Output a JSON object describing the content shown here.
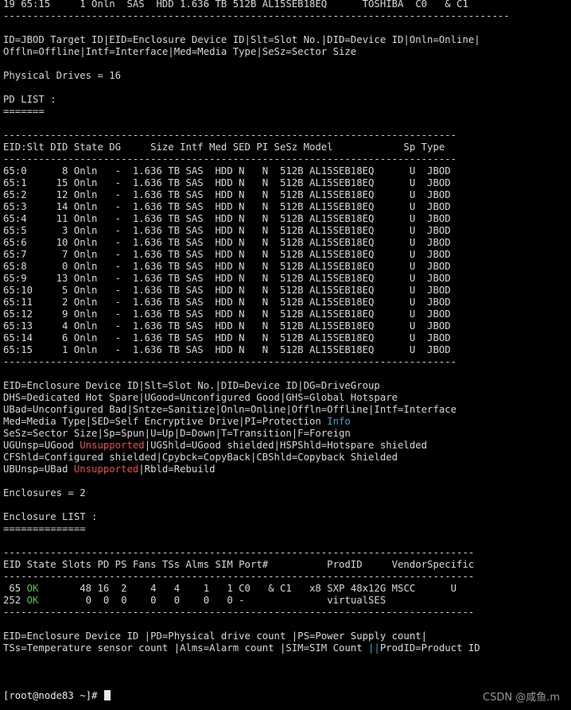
{
  "terminal": {
    "lines": [
      [
        {
          "t": "19 65:15     1 Onln  SAS  HDD 1.636 TB 512B AL15SEB18EQ      TOSHIBA  C0   & C1"
        }
      ],
      [
        {
          "t": "--------------------------------------------------------------------------------------"
        }
      ],
      [
        {
          "t": ""
        }
      ],
      [
        {
          "t": "ID=JBOD Target ID|EID=Enclosure Device ID|Slt=Slot No.|DID=Device ID|Onln=Online|"
        }
      ],
      [
        {
          "t": "Offln=Offline|Intf=Interface|Med=Media Type|SeSz=Sector Size"
        }
      ],
      [
        {
          "t": ""
        }
      ],
      [
        {
          "t": "Physical Drives = 16"
        }
      ],
      [
        {
          "t": ""
        }
      ],
      [
        {
          "t": "PD LIST :"
        }
      ],
      [
        {
          "t": "======="
        }
      ],
      [
        {
          "t": ""
        }
      ],
      [
        {
          "t": "-----------------------------------------------------------------------------"
        }
      ],
      [
        {
          "t": "EID:Slt DID State DG     Size Intf Med SED PI SeSz Model            Sp Type"
        }
      ],
      [
        {
          "t": "-----------------------------------------------------------------------------"
        }
      ],
      [
        {
          "t": "65:0      8 Onln   -  1.636 TB SAS  HDD N   N  512B AL15SEB18EQ      U  JBOD"
        }
      ],
      [
        {
          "t": "65:1     15 Onln   -  1.636 TB SAS  HDD N   N  512B AL15SEB18EQ      U  JBOD"
        }
      ],
      [
        {
          "t": "65:2     12 Onln   -  1.636 TB SAS  HDD N   N  512B AL15SEB18EQ      U  JBOD"
        }
      ],
      [
        {
          "t": "65:3     14 Onln   -  1.636 TB SAS  HDD N   N  512B AL15SEB18EQ      U  JBOD"
        }
      ],
      [
        {
          "t": "65:4     11 Onln   -  1.636 TB SAS  HDD N   N  512B AL15SEB18EQ      U  JBOD"
        }
      ],
      [
        {
          "t": "65:5      3 Onln   -  1.636 TB SAS  HDD N   N  512B AL15SEB18EQ      U  JBOD"
        }
      ],
      [
        {
          "t": "65:6     10 Onln   -  1.636 TB SAS  HDD N   N  512B AL15SEB18EQ      U  JBOD"
        }
      ],
      [
        {
          "t": "65:7      7 Onln   -  1.636 TB SAS  HDD N   N  512B AL15SEB18EQ      U  JBOD"
        }
      ],
      [
        {
          "t": "65:8      0 Onln   -  1.636 TB SAS  HDD N   N  512B AL15SEB18EQ      U  JBOD"
        }
      ],
      [
        {
          "t": "65:9     13 Onln   -  1.636 TB SAS  HDD N   N  512B AL15SEB18EQ      U  JBOD"
        }
      ],
      [
        {
          "t": "65:10     5 Onln   -  1.636 TB SAS  HDD N   N  512B AL15SEB18EQ      U  JBOD"
        }
      ],
      [
        {
          "t": "65:11     2 Onln   -  1.636 TB SAS  HDD N   N  512B AL15SEB18EQ      U  JBOD"
        }
      ],
      [
        {
          "t": "65:12     9 Onln   -  1.636 TB SAS  HDD N   N  512B AL15SEB18EQ      U  JBOD"
        }
      ],
      [
        {
          "t": "65:13     4 Onln   -  1.636 TB SAS  HDD N   N  512B AL15SEB18EQ      U  JBOD"
        }
      ],
      [
        {
          "t": "65:14     6 Onln   -  1.636 TB SAS  HDD N   N  512B AL15SEB18EQ      U  JBOD"
        }
      ],
      [
        {
          "t": "65:15     1 Onln   -  1.636 TB SAS  HDD N   N  512B AL15SEB18EQ      U  JBOD"
        }
      ],
      [
        {
          "t": "-----------------------------------------------------------------------------"
        }
      ],
      [
        {
          "t": ""
        }
      ],
      [
        {
          "t": "EID=Enclosure Device ID|Slt=Slot No.|DID=Device ID|DG=DriveGroup"
        }
      ],
      [
        {
          "t": "DHS=Dedicated Hot Spare|UGood=Unconfigured Good|GHS=Global Hotspare"
        }
      ],
      [
        {
          "t": "UBad=Unconfigured Bad|Sntze=Sanitize|Onln=Online|Offln=Offline|Intf=Interface"
        }
      ],
      [
        {
          "t": "Med=Media Type|SED=Self Encryptive Drive|PI=Protection "
        },
        {
          "t": "Info",
          "c": "blue"
        }
      ],
      [
        {
          "t": "SeSz=Sector Size|Sp=Spun|U=Up|D=Down|T=Transition|F=Foreign"
        }
      ],
      [
        {
          "t": "UGUnsp=UGood "
        },
        {
          "t": "Unsupported",
          "c": "red"
        },
        {
          "t": "|UGShld=UGood shielded|HSPShld=Hotspare shielded"
        }
      ],
      [
        {
          "t": "CFShld=Configured shielded|Cpybck=CopyBack|CBShld=Copyback Shielded"
        }
      ],
      [
        {
          "t": "UBUnsp=UBad "
        },
        {
          "t": "Unsupported",
          "c": "red"
        },
        {
          "t": "|Rbld=Rebuild"
        }
      ],
      [
        {
          "t": ""
        }
      ],
      [
        {
          "t": "Enclosures = 2"
        }
      ],
      [
        {
          "t": ""
        }
      ],
      [
        {
          "t": "Enclosure LIST :"
        }
      ],
      [
        {
          "t": "=============="
        }
      ],
      [
        {
          "t": ""
        }
      ],
      [
        {
          "t": "--------------------------------------------------------------------------------"
        }
      ],
      [
        {
          "t": "EID State Slots PD PS Fans TSs Alms SIM Port#          ProdID     VendorSpecific"
        }
      ],
      [
        {
          "t": "--------------------------------------------------------------------------------"
        }
      ],
      [
        {
          "t": " 65 "
        },
        {
          "t": "OK",
          "c": "green"
        },
        {
          "t": "       48 16  2    4   4    1   1 C0   & C1   x8 SXP 48x12G MSCC      U"
        }
      ],
      [
        {
          "t": "252 "
        },
        {
          "t": "OK",
          "c": "green"
        },
        {
          "t": "        0  0  0    0   0    0   0 -              virtualSES"
        }
      ],
      [
        {
          "t": "--------------------------------------------------------------------------------"
        }
      ],
      [
        {
          "t": ""
        }
      ],
      [
        {
          "t": "EID=Enclosure Device ID |PD=Physical drive count |PS=Power Supply count|"
        }
      ],
      [
        {
          "t": "TSs=Temperature sensor count |Alms=Alarm count |SIM=SIM Count "
        },
        {
          "t": "||",
          "c": "blue"
        },
        {
          "t": "ProdID=Product ID"
        }
      ],
      [
        {
          "t": ""
        }
      ],
      [
        {
          "t": ""
        }
      ],
      [
        {
          "t": ""
        }
      ],
      [
        {
          "t": "[root@node83 ~]# ",
          "c": "prompt"
        }
      ]
    ]
  },
  "watermark": "CSDN @咸鱼.m",
  "colors": {
    "background": "#000000",
    "text": "#d8d8d8",
    "green": "#4ec24e",
    "red": "#e0524c",
    "blue": "#39a6d6"
  }
}
